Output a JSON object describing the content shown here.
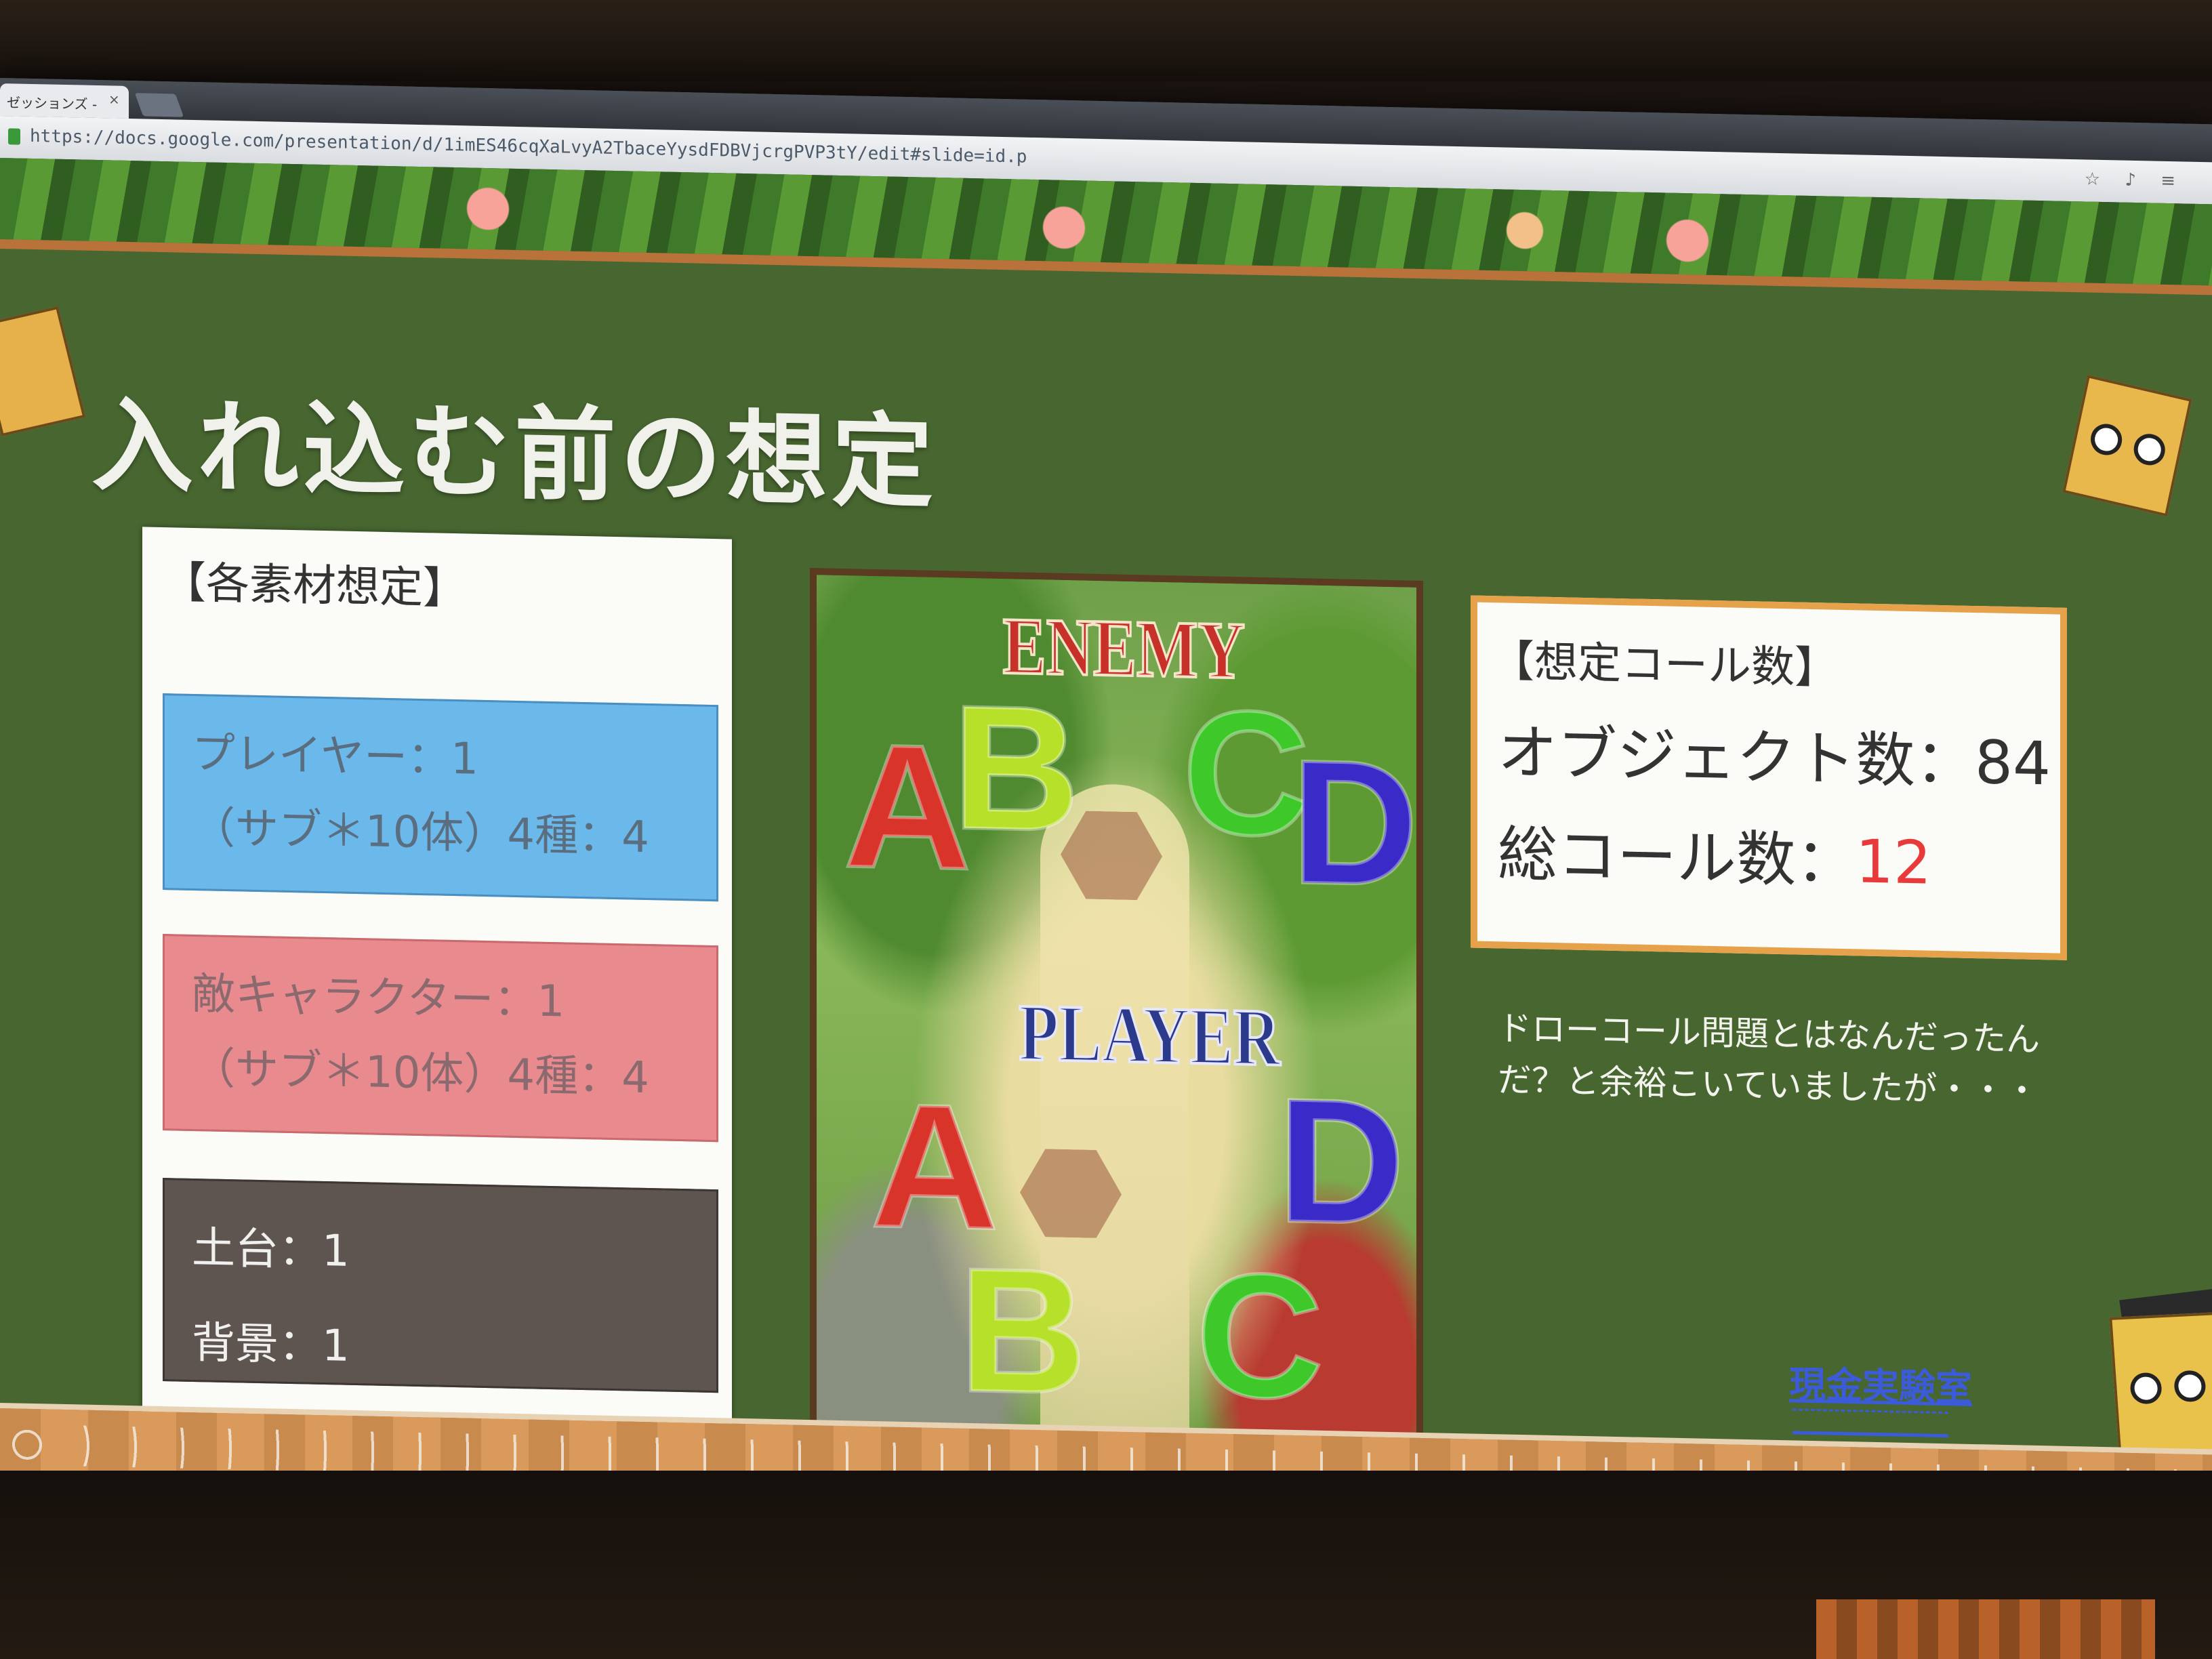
{
  "browser": {
    "tab_title": "ゼッションズ -",
    "tab_close": "×",
    "url": "https://docs.google.com/presentation/d/1imES46cqXaLvyA2TbaceYysdFDBVjcrgPVP3tY/edit#slide=id.p",
    "toolbar_icons": "☆ ♪ ≡"
  },
  "slide": {
    "title": "入れ込む前の想定",
    "materials": {
      "header": "【各素材想定】",
      "player_card": {
        "line1": "プレイヤー：1",
        "line2": "（サブ＊10体）4種：4"
      },
      "enemy_card": {
        "line1": "敵キャラクター：1",
        "line2": "（サブ＊10体）4種：4"
      },
      "stage_card": {
        "line1": "土台：1",
        "line2": "背景：1"
      }
    },
    "game_screenshot": {
      "enemy_label": "ENEMY",
      "player_label": "PLAYER",
      "enemy_letters": [
        "A",
        "B",
        "C",
        "D"
      ],
      "player_letters": [
        "A",
        "B",
        "C",
        "D"
      ],
      "letter_colors": {
        "A": "#d8342a",
        "B": "#b6e02a",
        "C": "#3ec82a",
        "D": "#3a2ac8"
      }
    },
    "call_counts": {
      "header": "【想定コール数】",
      "objects_label": "オブジェクト数：",
      "objects_value": "84",
      "total_label": "総コール数：",
      "total_value": "12",
      "total_value_color": "#e83a3a"
    },
    "note": "ドローコール問題とはなんだったんだ？と余裕こいていましたが・・・",
    "footer_logo": "現金実験室"
  }
}
